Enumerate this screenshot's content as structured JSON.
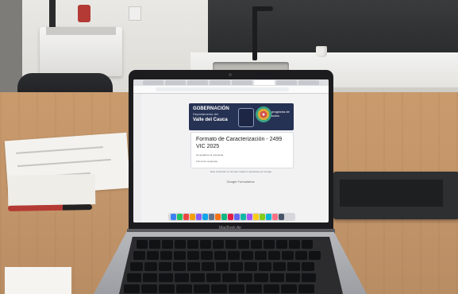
{
  "scene": {
    "laptop_model_label": "MacBook Air"
  },
  "browser": {
    "form": {
      "banner_title": "GOBERNACIÓN",
      "banner_subtitle": "Departamento del",
      "banner_department": "Valle del Cauca",
      "banner_brand": "programa de todos",
      "title": "Formato de Caracterización - 2499 VIC 2025",
      "note_1": "Se agradece la respuesta",
      "note_2": "Forma de respuesta",
      "footer_text": "Este contenido no ha sido creado ni aprobado por Google.",
      "footer_brand": "Google Formularios"
    },
    "dock_colors": [
      "#3b82f6",
      "#22c55e",
      "#ef4444",
      "#f59e0b",
      "#8b5cf6",
      "#0ea5e9",
      "#64748b",
      "#f97316",
      "#10b981",
      "#e11d48",
      "#6366f1",
      "#14b8a6",
      "#a855f7",
      "#facc15",
      "#84cc16",
      "#06b6d4",
      "#fb7185",
      "#475569"
    ]
  }
}
